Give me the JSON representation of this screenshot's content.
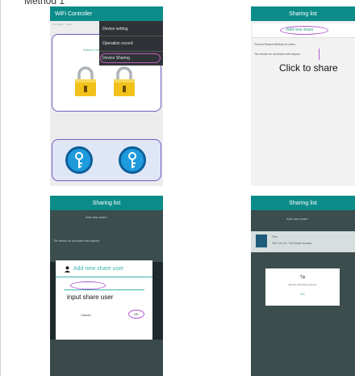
{
  "heading": "Method 1",
  "screen1": {
    "title": "WiFi Controller",
    "subtitle": "The Mayan · Admin",
    "lock_caption": "Select a lock",
    "menu": [
      "Device setting",
      "Operation record",
      "Device Sharing"
    ]
  },
  "screen2": {
    "title": "Sharing list",
    "add_button": "Add new share",
    "hint": "Current Shared list/Add for users",
    "empty": "The device do not share with anyone",
    "annotation": "Click to share"
  },
  "screen3": {
    "title": "Sharing list",
    "add_button": "Add new share",
    "hint": "The device do not share with anyone",
    "dialog_title": "Add new share user",
    "annotation": "input share user",
    "cancel": "Cancel",
    "ok": "OK"
  },
  "screen4": {
    "title": "Sharing list",
    "add_button": "Add new share",
    "list_name": "Tom",
    "list_detail": "2017-04-13 · Full Share Access",
    "dialog_title": "Tip",
    "dialog_message": "Shares submitted success",
    "dialog_ok": "OK"
  }
}
